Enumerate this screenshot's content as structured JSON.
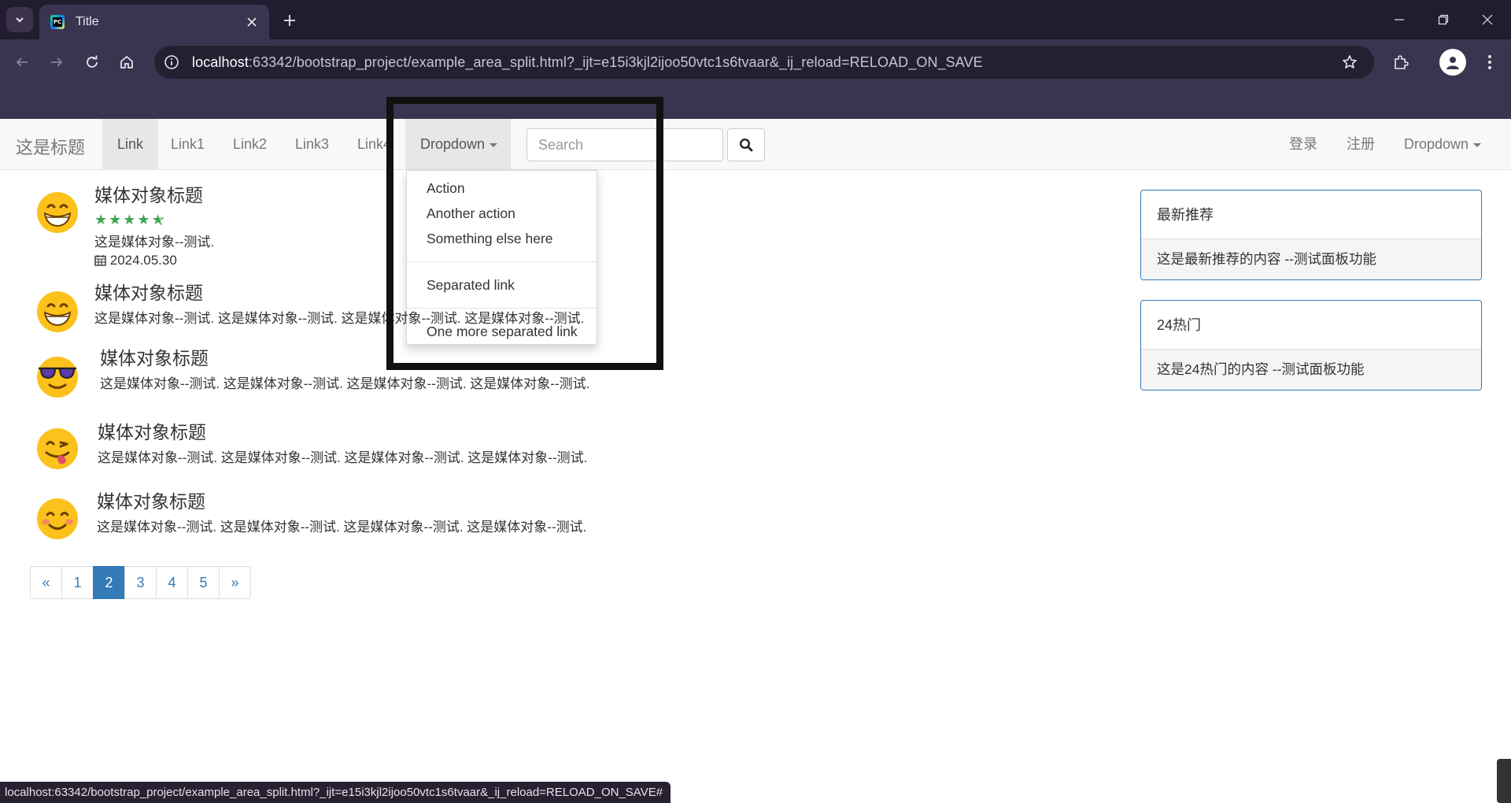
{
  "browser": {
    "tab_title": "Title",
    "url_host": "localhost",
    "url_rest": ":63342/bootstrap_project/example_area_split.html?_ijt=e15i3kjl2ijoo50vtc1s6tvaar&_ij_reload=RELOAD_ON_SAVE",
    "status_url": "localhost:63342/bootstrap_project/example_area_split.html?_ijt=e15i3kjl2ijoo50vtc1s6tvaar&_ij_reload=RELOAD_ON_SAVE#",
    "favicon_text": "PC"
  },
  "navbar": {
    "brand": "这是标题",
    "links": [
      "Link",
      "Link1",
      "Link2",
      "Link3",
      "Link4"
    ],
    "dropdown_label": "Dropdown",
    "search_placeholder": "Search",
    "right_links": [
      "登录",
      "注册"
    ],
    "right_dropdown_label": "Dropdown"
  },
  "dropdown_menu": {
    "items": [
      "Action",
      "Another action",
      "Something else here"
    ],
    "separated": "Separated link",
    "one_more": "One more separated link"
  },
  "media_list": [
    {
      "emoji": "😁",
      "heading": "媒体对象标题",
      "rating": "4.5 / 5",
      "text": "这是媒体对象--测试.",
      "date": "2024.05.30"
    },
    {
      "emoji": "😁",
      "heading": "媒体对象标题",
      "text": "这是媒体对象--测试. 这是媒体对象--测试. 这是媒体对象--测试. 这是媒体对象--测试."
    },
    {
      "emoji": "😎",
      "heading": "媒体对象标题",
      "text": "这是媒体对象--测试. 这是媒体对象--测试. 这是媒体对象--测试. 这是媒体对象--测试."
    },
    {
      "emoji": "😋",
      "heading": "媒体对象标题",
      "text": "这是媒体对象--测试. 这是媒体对象--测试. 这是媒体对象--测试. 这是媒体对象--测试."
    },
    {
      "emoji": "😊",
      "heading": "媒体对象标题",
      "text": "这是媒体对象--测试. 这是媒体对象--测试. 这是媒体对象--测试. 这是媒体对象--测试."
    }
  ],
  "pagination": {
    "prev": "«",
    "pages": [
      "1",
      "2",
      "3",
      "4",
      "5"
    ],
    "active": "2",
    "next": "»"
  },
  "panels": [
    {
      "title": "最新推荐",
      "body": "这是最新推荐的内容 --测试面板功能"
    },
    {
      "title": "24热门",
      "body": "这是24热门的内容 --测试面板功能"
    }
  ],
  "colors": {
    "primary": "#337ab7",
    "star_green": "#3ca452",
    "browser_frame": "#3b3450"
  }
}
